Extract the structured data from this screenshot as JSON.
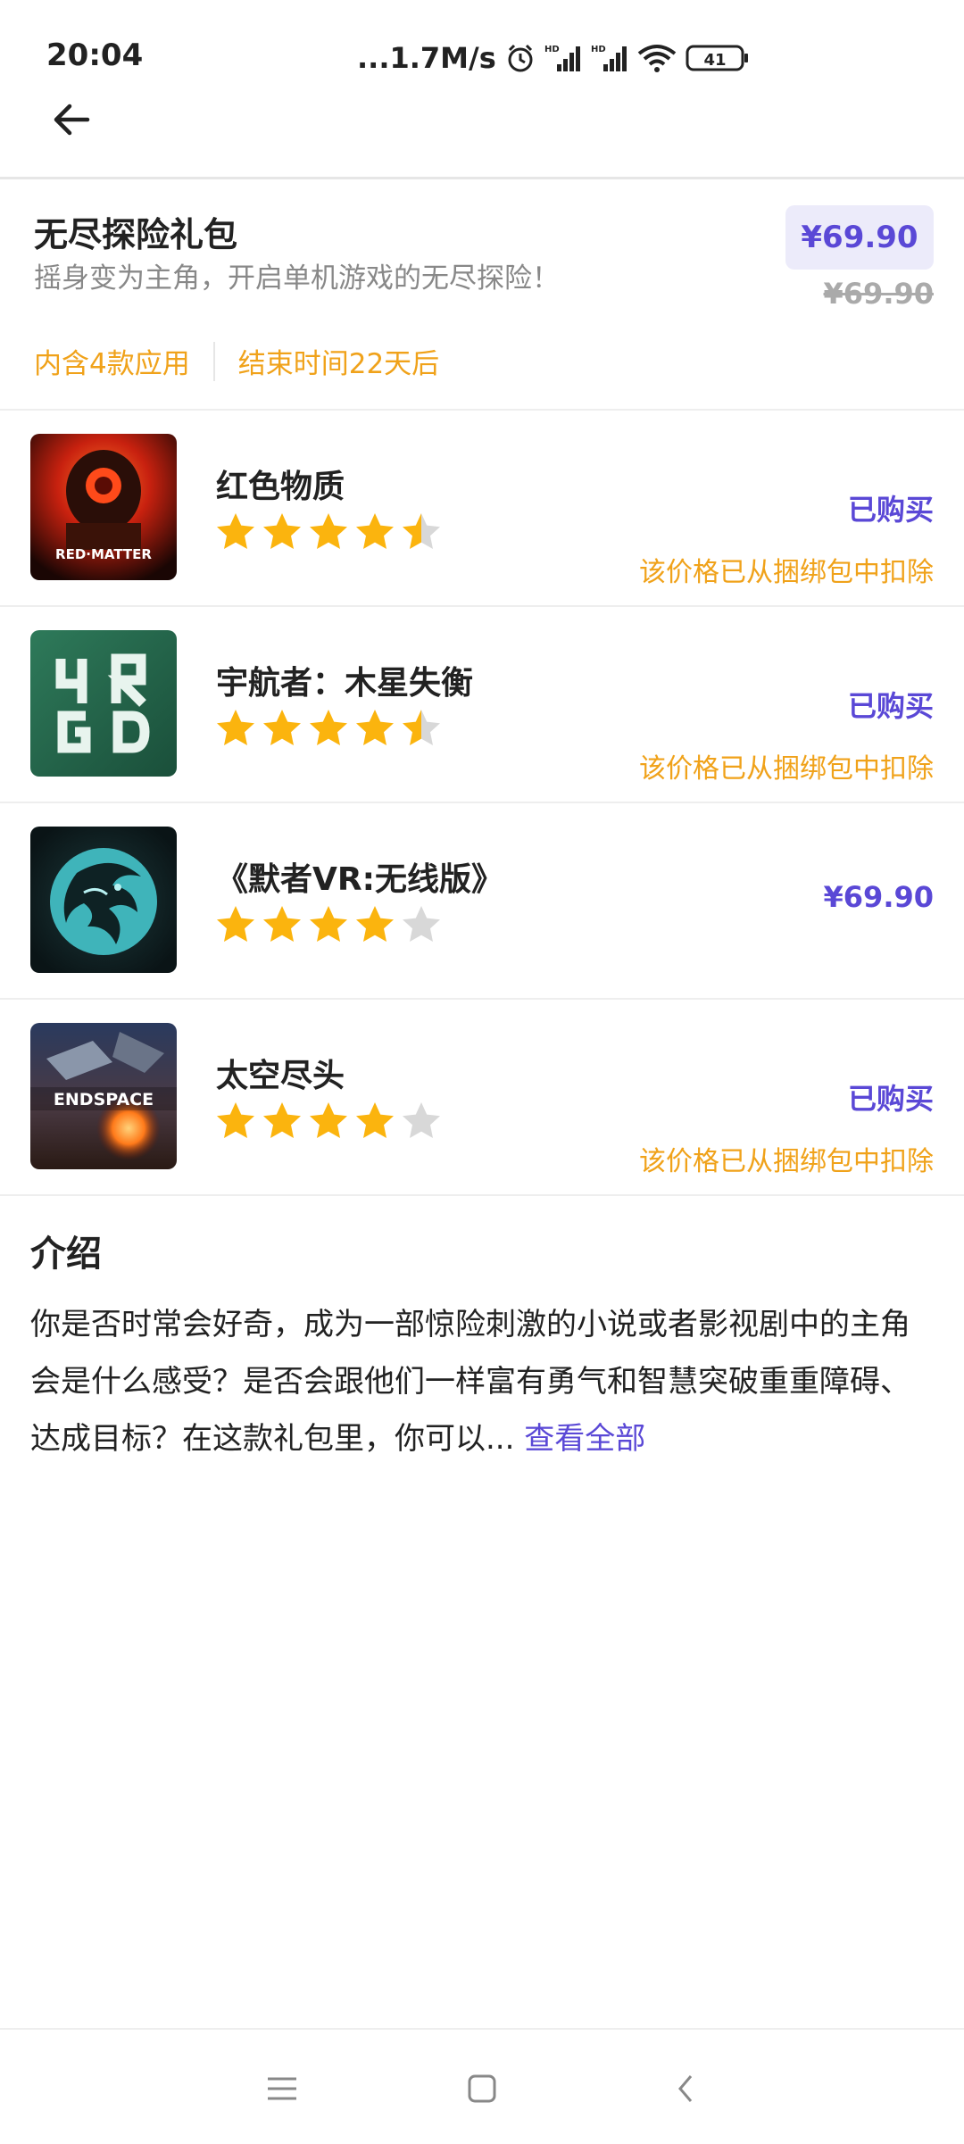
{
  "status_bar": {
    "time": "20:04",
    "network_speed": "...1.7M/s",
    "battery": "41"
  },
  "bundle": {
    "title": "无尽探险礼包",
    "subtitle": "摇身变为主角，开启单机游戏的无尽探险！",
    "price": "¥69.90",
    "original_price": "¥69.90",
    "app_count": "内含4款应用",
    "end_time": "结束时间22天后"
  },
  "apps": [
    {
      "name": "红色物质",
      "rating": 4.5,
      "status": "已购买",
      "note": "该价格已从捆绑包中扣除",
      "icon": "red-matter-icon"
    },
    {
      "name": "宇航者：木星失衡",
      "rating": 4.5,
      "status": "已购买",
      "note": "该价格已从捆绑包中扣除",
      "icon": "vrgd-icon"
    },
    {
      "name": "《默者VR:无线版》",
      "rating": 4,
      "price": "¥69.90",
      "icon": "dragon-icon"
    },
    {
      "name": "太空尽头",
      "rating": 4,
      "status": "已购买",
      "note": "该价格已从捆绑包中扣除",
      "icon": "end-space-icon"
    }
  ],
  "intro": {
    "title": "介绍",
    "text": "你是否时常会好奇，成为一部惊险刺激的小说或者影视剧中的主角会是什么感受？是否会跟他们一样富有勇气和智慧突破重重障碍、达成目标？在这款礼包里，你可以...",
    "view_all": "查看全部"
  },
  "icon_text": {
    "red_matter": "RED·MATTER",
    "end_space": "ENDSPACE"
  },
  "colors": {
    "accent": "#5a48d6",
    "accent_bg": "#ecebfa",
    "warning": "#f0a21a",
    "star": "#fbb40e",
    "star_empty": "#d8d8d8"
  }
}
